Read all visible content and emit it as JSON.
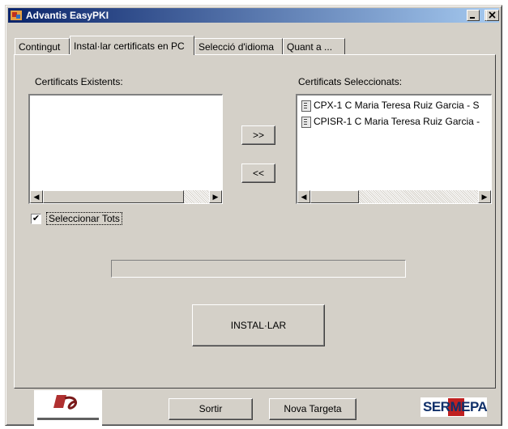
{
  "window": {
    "title": "Advantis EasyPKI",
    "colors": {
      "titlebar": "#0a246a",
      "face": "#d4d0c8"
    }
  },
  "tabs": [
    {
      "label": "Contingut"
    },
    {
      "label": "Instal·lar certificats en PC",
      "active": true
    },
    {
      "label": "Selecció d'idioma"
    },
    {
      "label": "Quant a ..."
    }
  ],
  "existing": {
    "label": "Certificats Existents:",
    "items": []
  },
  "selected": {
    "label": "Certificats Seleccionats:",
    "items": [
      {
        "text": "CPX-1 C Maria Teresa Ruiz Garcia - S",
        "icon": "certificate-icon"
      },
      {
        "text": "CPISR-1 C Maria Teresa Ruiz Garcia -",
        "icon": "certificate-icon"
      }
    ]
  },
  "buttons": {
    "add": ">>",
    "remove": "<<",
    "install": "INSTAL·LAR",
    "exit": "Sortir",
    "new_card": "Nova Targeta"
  },
  "select_all": {
    "label": "Seleccionar Tots",
    "checked": true
  },
  "progress": {
    "value": 0
  },
  "logos": {
    "left": {
      "name": "institution-logo",
      "caption": ""
    },
    "right": {
      "name": "sermepa-logo",
      "text": "SERMEPA"
    }
  }
}
